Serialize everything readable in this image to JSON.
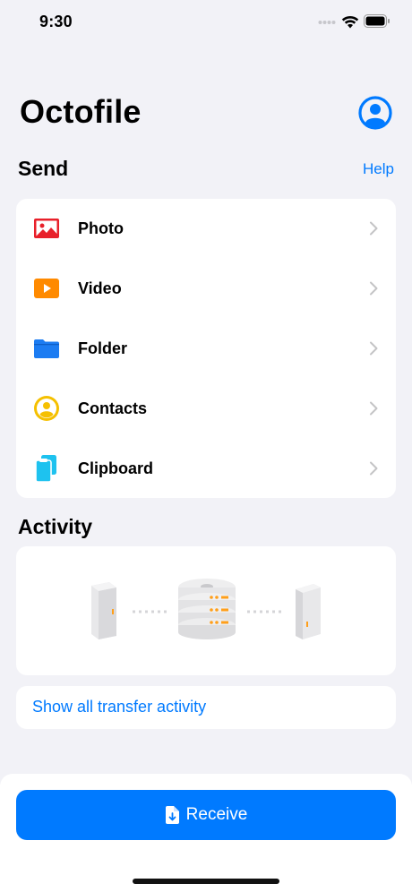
{
  "status_bar": {
    "time": "9:30"
  },
  "header": {
    "title": "Octofile",
    "profile_icon": "person-circle-icon"
  },
  "send": {
    "title": "Send",
    "help_label": "Help",
    "items": [
      {
        "label": "Photo",
        "icon": "photo-icon",
        "color": "#e8202a"
      },
      {
        "label": "Video",
        "icon": "video-play-icon",
        "color": "#ff8a00"
      },
      {
        "label": "Folder",
        "icon": "folder-icon",
        "color": "#1c7cf2"
      },
      {
        "label": "Contacts",
        "icon": "contact-icon",
        "color": "#f5c000"
      },
      {
        "label": "Clipboard",
        "icon": "clipboard-icon",
        "color": "#1ec2ef"
      }
    ]
  },
  "activity": {
    "title": "Activity",
    "show_all_label": "Show all transfer activity"
  },
  "receive": {
    "label": "Receive",
    "icon": "file-download-icon"
  },
  "colors": {
    "accent": "#007aff",
    "background": "#f2f2f7",
    "card": "#ffffff"
  }
}
